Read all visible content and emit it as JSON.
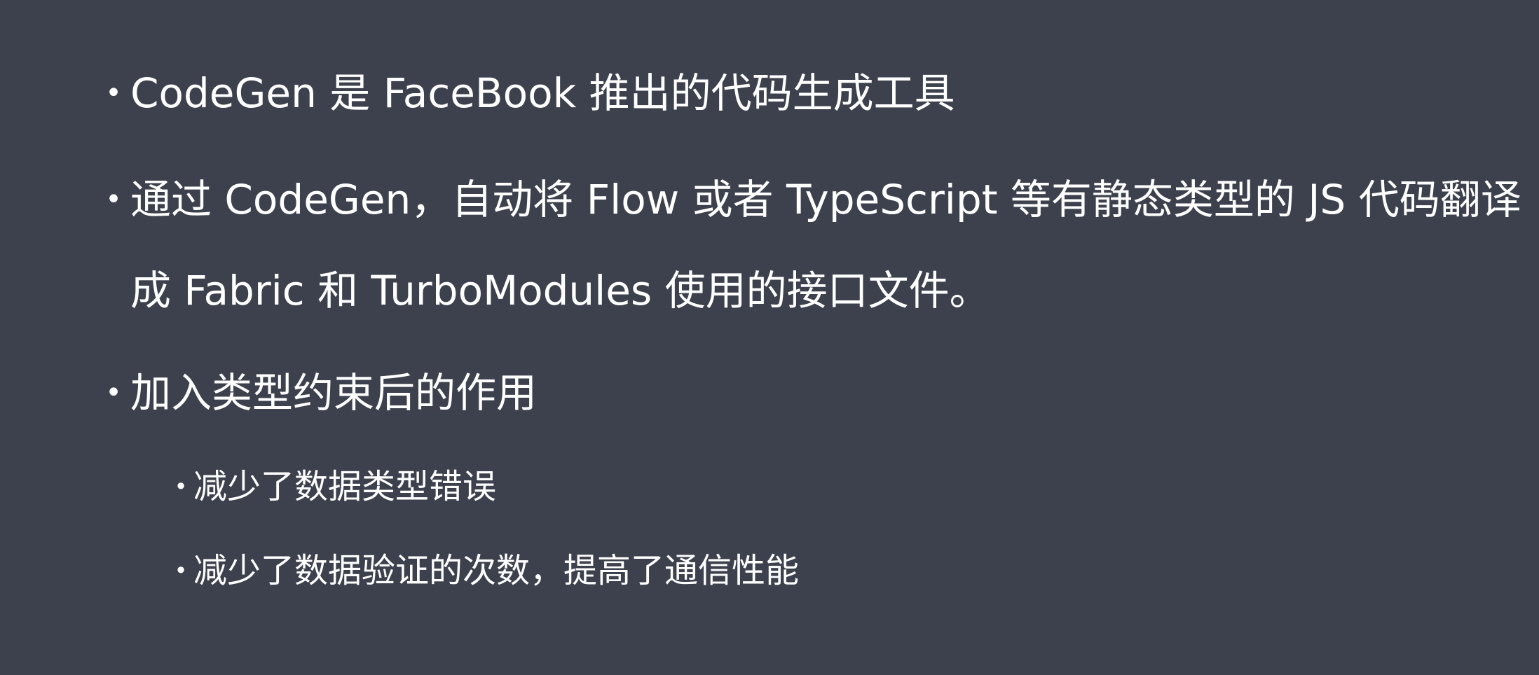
{
  "slide": {
    "bullets": [
      {
        "level": 1,
        "text": "CodeGen 是 FaceBook 推出的代码生成工具"
      },
      {
        "level": 1,
        "text": "通过 CodeGen，自动将 Flow 或者 TypeScript 等有静态类型的 JS 代码翻译成 Fabric 和 TurboModules 使用的接口文件。"
      },
      {
        "level": 1,
        "text": "加入类型约束后的作用"
      },
      {
        "level": 2,
        "text": "减少了数据类型错误"
      },
      {
        "level": 2,
        "text": "减少了数据验证的次数，提高了通信性能"
      }
    ],
    "bullet_symbol": "•",
    "colors": {
      "background": "#3d414d",
      "text": "#ffffff"
    }
  }
}
